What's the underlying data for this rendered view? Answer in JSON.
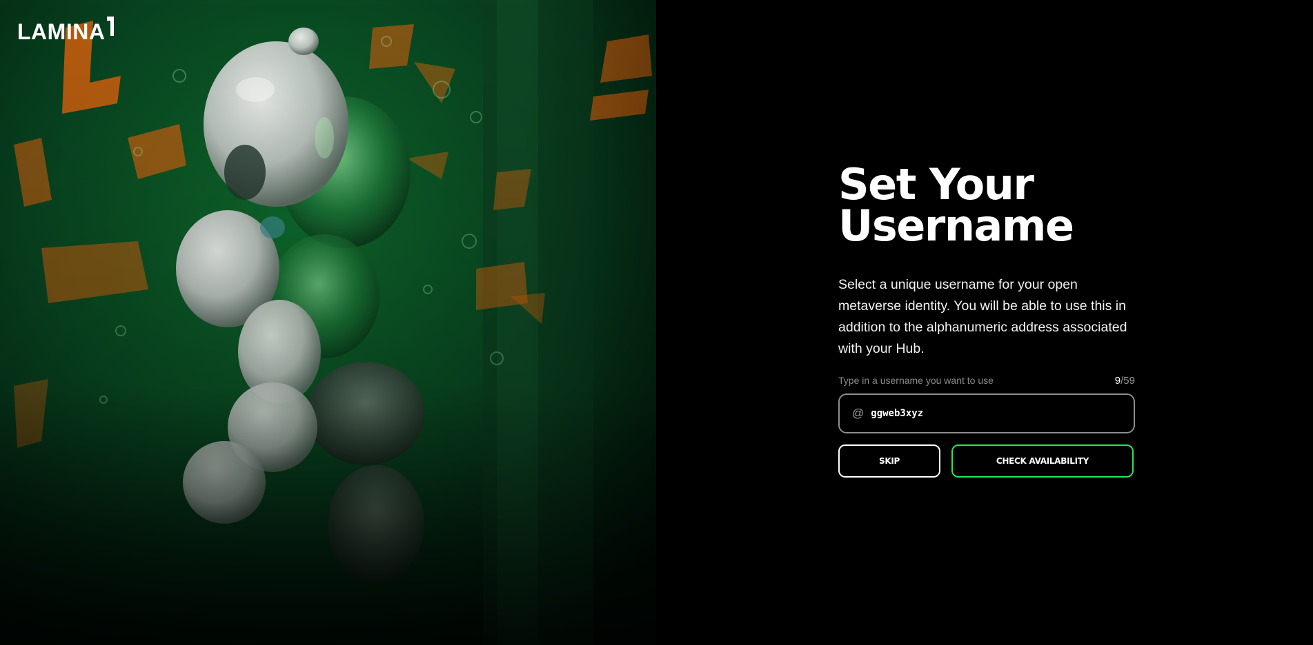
{
  "brand": {
    "logo_text": "LAMINA"
  },
  "form": {
    "title_line1": "Set Your",
    "title_line2": "Username",
    "description": "Select a unique username for your open metaverse identity. You will be able to use this in addition to the alphanumeric address associated with your Hub.",
    "input_label": "Type in a username you want to use",
    "char_count_current": "9",
    "char_count_max": "/59",
    "at_prefix": "@",
    "username_value": "ggweb3xyz",
    "skip_label": "SKIP",
    "check_label": "CHECK AVAILABILITY"
  },
  "colors": {
    "accent_green": "#20e85a",
    "background": "#000000",
    "art_green": "#0b5a26",
    "art_orange": "#d4600e"
  }
}
